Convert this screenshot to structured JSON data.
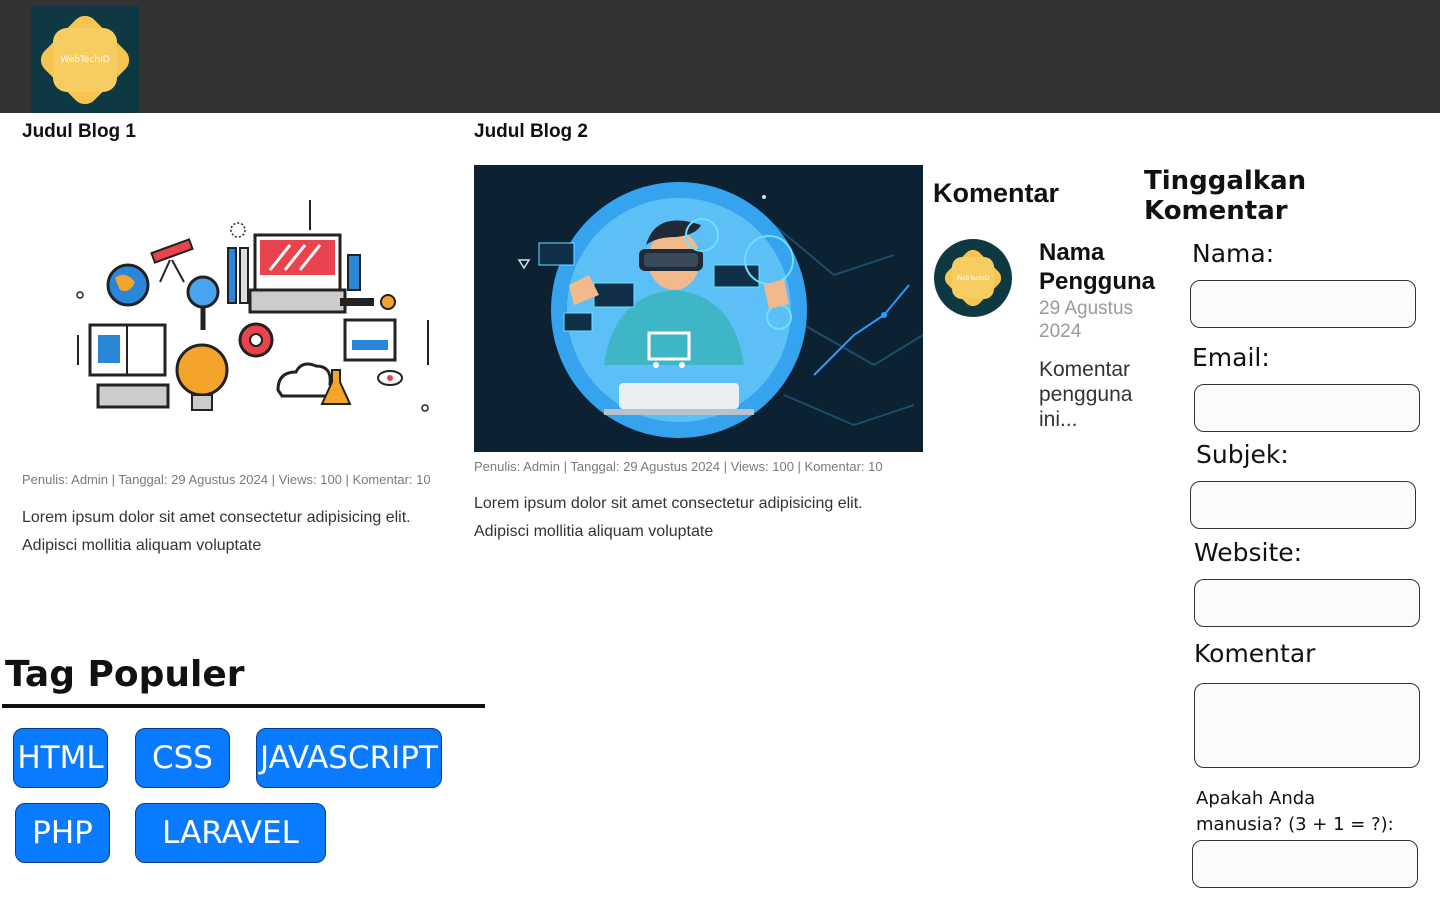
{
  "header": {
    "logo_text": "WebTechID"
  },
  "blogs": [
    {
      "title": "Judul Blog 1",
      "meta": "Penulis: Admin | Tanggal: 29 Agustus 2024 | Views: 100 | Komentar: 10",
      "excerpt": "Lorem ipsum dolor sit amet consectetur adipisicing elit. Adipisci mollitia aliquam voluptate"
    },
    {
      "title": "Judul Blog 2",
      "meta": "Penulis: Admin | Tanggal: 29 Agustus 2024 | Views: 100 | Komentar: 10",
      "excerpt": "Lorem ipsum dolor sit amet consectetur adipisicing elit. Adipisci mollitia aliquam voluptate"
    }
  ],
  "comments": {
    "heading": "Komentar",
    "avatar_text": "WebTechID",
    "name": "Nama Pengguna",
    "date": "29 Agustus 2024",
    "text": "Komentar pengguna ini..."
  },
  "form": {
    "heading": "Tinggalkan Komentar",
    "name_label": "Nama:",
    "email_label": "Email:",
    "subject_label": "Subjek:",
    "website_label": "Website:",
    "comment_label": "Komentar",
    "captcha_label": "Apakah Anda manusia? (3 + 1 = ?):"
  },
  "tags": {
    "heading": "Tag Populer",
    "items": [
      "HTML",
      "CSS",
      "JAVASCRIPT",
      "PHP",
      "LARAVEL"
    ]
  },
  "colors": {
    "header_bg": "#333333",
    "tag_bg": "#0a7aff",
    "logo_bg": "#0f3942",
    "logo_shape": "#f5c451"
  }
}
